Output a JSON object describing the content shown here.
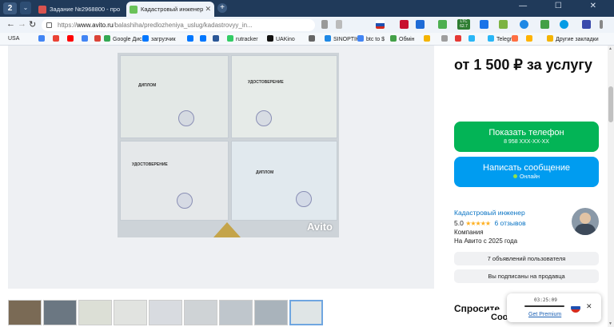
{
  "browser": {
    "tab_group": "2",
    "tabs": [
      {
        "title": "Задание №2968800 - про",
        "icon_color": "#d9534f"
      },
      {
        "title": "Кадастровый инженер",
        "icon_color": "#6ac259"
      }
    ],
    "address": {
      "protocol": "https://",
      "host": "www.avito.ru",
      "path": "/balashiha/predlozheniya_uslug/kadastrovyy_in..."
    },
    "window_controls": "— ☐ ✕",
    "extensions_colors": [
      "#c8102e",
      "#cc0000",
      "#1e6bd6",
      "#4caf50",
      "#2e7d32",
      "#1a73e8",
      "#7cb342",
      "#1e88e5",
      "#039be5",
      "#3949ab"
    ],
    "extension_ltc_label": "LTC",
    "extension_ltc_value": "62.7",
    "bookmarks": [
      {
        "label": "USA",
        "color": "#ffffff"
      },
      {
        "label": "",
        "color": "#4285f4"
      },
      {
        "label": "",
        "color": "#ea4335"
      },
      {
        "label": "",
        "color": "#ff0000"
      },
      {
        "label": "",
        "color": "#4285f4"
      },
      {
        "label": "",
        "color": "#db4437"
      },
      {
        "label": "Google Диск",
        "color": "#34a853"
      },
      {
        "label": "загрузчик",
        "color": "#0077ff"
      },
      {
        "label": "",
        "color": "#0077ff"
      },
      {
        "label": "",
        "color": "#0077ff"
      },
      {
        "label": "",
        "color": "#2b5797"
      },
      {
        "label": "rutracker",
        "color": "#3c6"
      },
      {
        "label": "UAKino",
        "color": "#111"
      },
      {
        "label": "",
        "color": "#666"
      },
      {
        "label": "SINOPTIK",
        "color": "#1e88e5"
      },
      {
        "label": "btc to $",
        "color": "#4285f4"
      },
      {
        "label": "Обмін",
        "color": "#43a047"
      },
      {
        "label": "",
        "color": "#f4b400"
      },
      {
        "label": "",
        "color": "#9e9e9e"
      },
      {
        "label": "",
        "color": "#e53935"
      },
      {
        "label": "",
        "color": "#29b6f6"
      },
      {
        "label": "Telegr",
        "color": "#29b6f6"
      },
      {
        "label": "",
        "color": "#ff7043"
      },
      {
        "label": "",
        "color": "#ffb300"
      },
      {
        "label": "Другие закладки",
        "color": "#f4b400"
      }
    ]
  },
  "listing": {
    "price": "от 1 500 ₽ за услугу",
    "phone_button": {
      "label": "Показать телефон",
      "number": "8 958 XXX-XX-XX"
    },
    "message_button": {
      "label": "Написать сообщение",
      "status": "Онлайн"
    },
    "seller": {
      "name": "Кадастровый инженер",
      "rating": "5.0",
      "stars": "★★★★★",
      "reviews": "6 отзывов",
      "type": "Компания",
      "since": "На Авито с 2025 года"
    },
    "user_listings": "7 объявлений пользователя",
    "subscribed": "Вы подписаны на продавца",
    "questions_heading": "Спросите",
    "questions_heading_behind": "Соо",
    "photo_watermark": "Avito",
    "photo_docs": [
      {
        "title": "ДИПЛОМ"
      },
      {
        "title": "УДОСТОВЕРЕНИЕ"
      },
      {
        "title": "УДОСТОВЕРЕНИЕ"
      },
      {
        "title": "ДИПЛОМ"
      }
    ],
    "thumbnail_count": 9,
    "selected_thumbnail": 8
  },
  "vpn": {
    "timer": "03:25:09",
    "link": "Get Premium"
  }
}
